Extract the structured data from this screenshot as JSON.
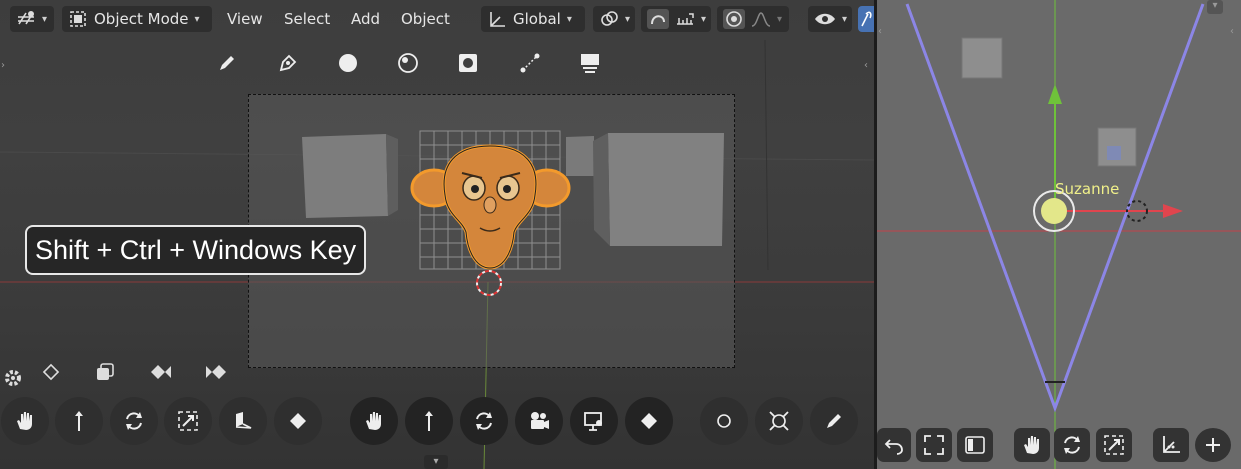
{
  "header": {
    "mode_label": "Object Mode",
    "menus": [
      "View",
      "Select",
      "Add",
      "Object"
    ],
    "orientation_label": "Global"
  },
  "overlay": {
    "key_combo": "Shift + Ctrl + Windows Key"
  },
  "right_viewport": {
    "object_label": "Suzanne"
  },
  "colors": {
    "viewport_bg": "#404040",
    "side_viewport_bg": "#6a6a6a",
    "camera_frame_lines": "#8c86e6",
    "x_axis": "#e0454e",
    "y_axis": "#6fc23a",
    "selection_outline": "#f39a2c",
    "active_toggle": "#4772b3"
  },
  "icons": {
    "toolbar": [
      "pencil-icon",
      "pen-icon",
      "circle-fill-icon",
      "sphere-icon",
      "mask-icon",
      "curve-icon",
      "stack-icon"
    ],
    "keyframes": [
      "settings-icon",
      "keyframe-icon",
      "keyframe-layers-icon",
      "keyframe-prev-icon",
      "keyframe-next-icon"
    ],
    "nav_left": [
      "hand-icon",
      "move-icon",
      "rotate-icon",
      "scale-icon",
      "transform-icon",
      "keyframe-icon"
    ],
    "nav_mid": [
      "hand-icon",
      "move-icon",
      "rotate-icon",
      "camera-icon",
      "view-icon",
      "keyframe-icon"
    ],
    "nav_right": [
      "circle-icon",
      "select-icon",
      "pencil-icon"
    ],
    "right_bottom": [
      "undo-icon",
      "frame-icon",
      "sidebar-icon",
      "hand-icon",
      "rotate-icon",
      "scale-icon",
      "axes-icon",
      "add-icon"
    ]
  }
}
